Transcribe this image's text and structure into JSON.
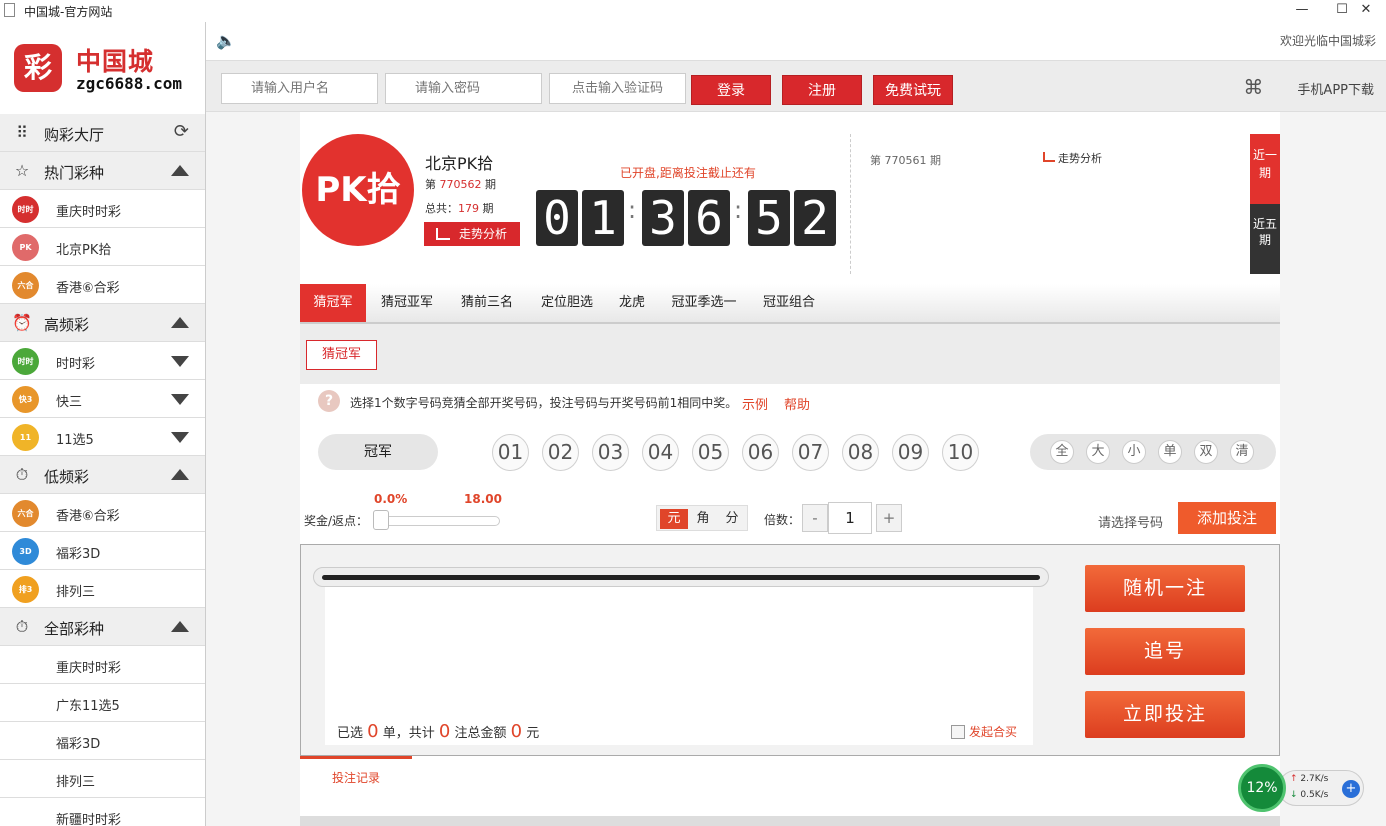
{
  "window": {
    "title": "中国城-官方网站",
    "minimize": "—",
    "maximize": "☐",
    "close": "✕"
  },
  "brand": {
    "mark": "彩",
    "name": "中国城",
    "url": "zgc6688.com"
  },
  "sidebar": {
    "lobby": "购彩大厅",
    "sections": [
      {
        "label": "热门彩种",
        "items": [
          "重庆时时彩",
          "北京PK拾",
          "香港⑥合彩"
        ]
      },
      {
        "label": "高频彩",
        "items": [
          "时时彩",
          "快三",
          "11选5"
        ]
      },
      {
        "label": "低频彩",
        "items": [
          "香港⑥合彩",
          "福彩3D",
          "排列三"
        ]
      },
      {
        "label": "全部彩种",
        "items": [
          "重庆时时彩",
          "广东11选5",
          "福彩3D",
          "排列三",
          "新疆时时彩"
        ]
      }
    ]
  },
  "topbar": {
    "welcome": "欢迎光临中国城彩"
  },
  "login": {
    "username_placeholder": "请输入用户名",
    "password_placeholder": "请输入密码",
    "captcha_placeholder": "点击输入验证码",
    "login": "登录",
    "register": "注册",
    "trial": "免费试玩",
    "app_download": "手机APP下载"
  },
  "lottery": {
    "badge": "PK拾",
    "name": "北京PK拾",
    "issue_prefix": "第",
    "issue": "770562",
    "issue_suffix": "期",
    "total_prefix": "总共：",
    "total": "179",
    "total_suffix": "期",
    "trend": "走势分析",
    "open_text": "已开盘,距离投注截止还有",
    "countdown": [
      "0",
      "1",
      "3",
      "6",
      "5",
      "2"
    ],
    "last_issue": "第 770561 期",
    "trend2": "走势分析",
    "tab_recent": "近一期",
    "tab_recent5": "近五期"
  },
  "tabs": [
    "猜冠军",
    "猜冠亚军",
    "猜前三名",
    "定位胆选",
    "龙虎",
    "冠亚季选一",
    "冠亚组合"
  ],
  "subtab": "猜冠军",
  "hint": {
    "text": "选择1个数字号码竞猜全部开奖号码，投注号码与开奖号码前1相同中奖。",
    "example": "示例",
    "help": "帮助"
  },
  "position": "冠军",
  "balls": [
    "01",
    "02",
    "03",
    "04",
    "05",
    "06",
    "07",
    "08",
    "09",
    "10"
  ],
  "quick": [
    "全",
    "大",
    "小",
    "单",
    "双",
    "清"
  ],
  "rebate": {
    "label": "奖金/返点：",
    "min": "0.0%",
    "max": "18.00"
  },
  "units": [
    "元",
    "角",
    "分"
  ],
  "multiplier": {
    "label": "倍数：",
    "minus": "-",
    "value": "1",
    "plus": "+"
  },
  "pick_text": "请选择号码",
  "add_bet": "添加投注",
  "summary": {
    "p1": "已选",
    "count": "0",
    "p2": "单，共计",
    "notes": "0",
    "p3": "注总金额",
    "amount": "0",
    "p4": "元"
  },
  "hemai": "发起合买",
  "actions": {
    "random": "随机一注",
    "chase": "追号",
    "submit": "立即投注"
  },
  "records": "投注记录",
  "net": {
    "percent": "12%",
    "up": "2.7K/s",
    "down": "0.5K/s"
  }
}
